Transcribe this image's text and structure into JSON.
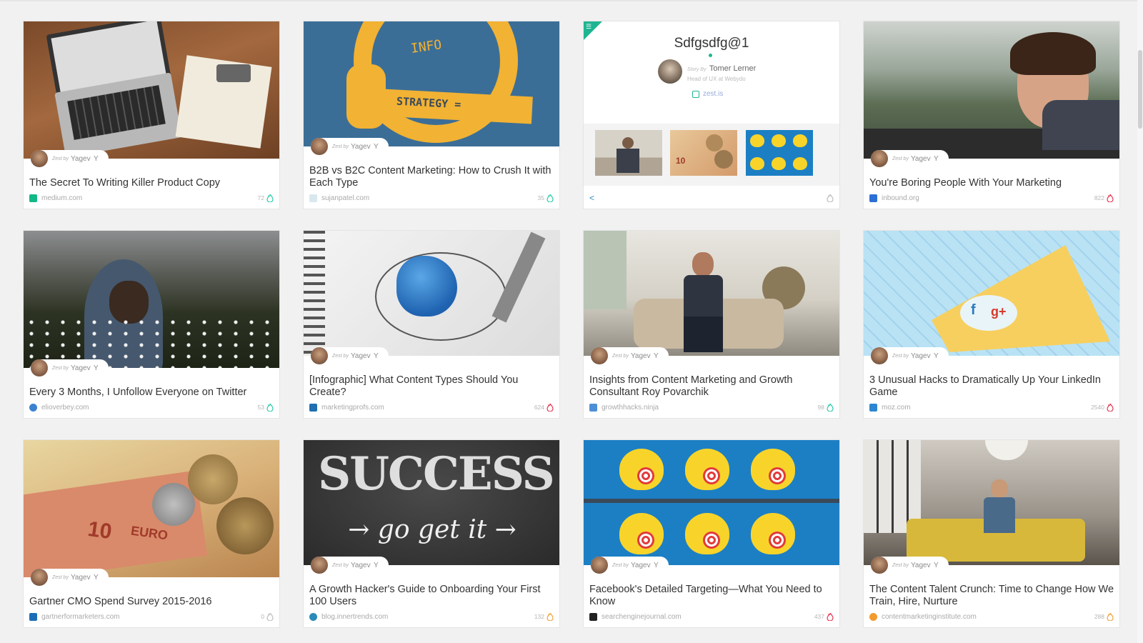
{
  "colors": {
    "accent": "#1fb592",
    "page_background": "#f1f1f1",
    "card_background": "#ffffff",
    "title_text": "#333333",
    "muted_text": "#aaaaaa"
  },
  "curator": {
    "prefix": "Zest by",
    "name": "Yagev",
    "suffix": "Y"
  },
  "cards": [
    {
      "title": "The Secret To Writing Killer Product Copy",
      "source": "medium.com",
      "count": "72",
      "source_icon": "medium-icon",
      "source_color": "#12b886",
      "flame_color": "#2dc9a7"
    },
    {
      "title": "B2B vs B2C Content Marketing: How to Crush It with Each Type",
      "source": "sujanpatel.com",
      "count": "35",
      "source_icon": "sujanpatel-icon",
      "source_color": "#d9e8ef",
      "flame_color": "#2dc9a7"
    },
    {
      "type": "story"
    },
    {
      "title": "You're Boring People With Your Marketing",
      "source": "inbound.org",
      "count": "822",
      "source_icon": "inbound-icon",
      "source_color": "#2c6fd6",
      "flame_color": "#e5344f"
    },
    {
      "title": "Every 3 Months, I Unfollow Everyone on Twitter",
      "source": "elioverbey.com",
      "count": "53",
      "source_icon": "elioverbey-icon",
      "source_color": "#3a82d0",
      "flame_color": "#2dc9a7"
    },
    {
      "title": "[Infographic] What Content Types Should You Create?",
      "source": "marketingprofs.com",
      "count": "624",
      "source_icon": "marketingprofs-icon",
      "source_color": "#1f6fb2",
      "flame_color": "#e5344f"
    },
    {
      "title": "Insights from Content Marketing and Growth Consultant Roy Povarchik",
      "source": "growthhacks.ninja",
      "count": "98",
      "source_icon": "growthhacks-icon",
      "source_color": "#4d8fd6",
      "flame_color": "#2dc9a7"
    },
    {
      "title": "3 Unusual Hacks to Dramatically Up Your LinkedIn Game",
      "source": "moz.com",
      "count": "2540",
      "source_icon": "moz-icon",
      "source_color": "#2c86d1",
      "flame_color": "#e5344f"
    },
    {
      "title": "Gartner CMO Spend Survey 2015-2016",
      "source": "gartnerformarketers.com",
      "count": "0",
      "source_icon": "gartner-icon",
      "source_color": "#1b6eb6",
      "flame_color": "#bcbcbc"
    },
    {
      "title": "A Growth Hacker's Guide to Onboarding Your First 100 Users",
      "source": "blog.innertrends.com",
      "count": "132",
      "source_icon": "innertrends-icon",
      "source_color": "#2a8ab8",
      "flame_color": "#f2a23a"
    },
    {
      "title": "Facebook's Detailed Targeting—What You Need to Know",
      "source": "searchenginejournal.com",
      "count": "437",
      "source_icon": "sej-icon",
      "source_color": "#222222",
      "flame_color": "#e5344f"
    },
    {
      "title": "The Content Talent Crunch: Time to Change How We Train, Hire, Nurture",
      "source": "contentmarketinginstitute.com",
      "count": "288",
      "source_icon": "cmi-icon",
      "source_color": "#f29a2e",
      "flame_color": "#f2a23a"
    }
  ],
  "story": {
    "title": "Sdfgsdfg@1",
    "by_label": "Story By",
    "author": "Tomer Lerner",
    "author_role": "Head of UX at Webydo",
    "platform": "zest.is",
    "share_icon": "share-icon",
    "flame_icon": "flame-outline-icon"
  }
}
